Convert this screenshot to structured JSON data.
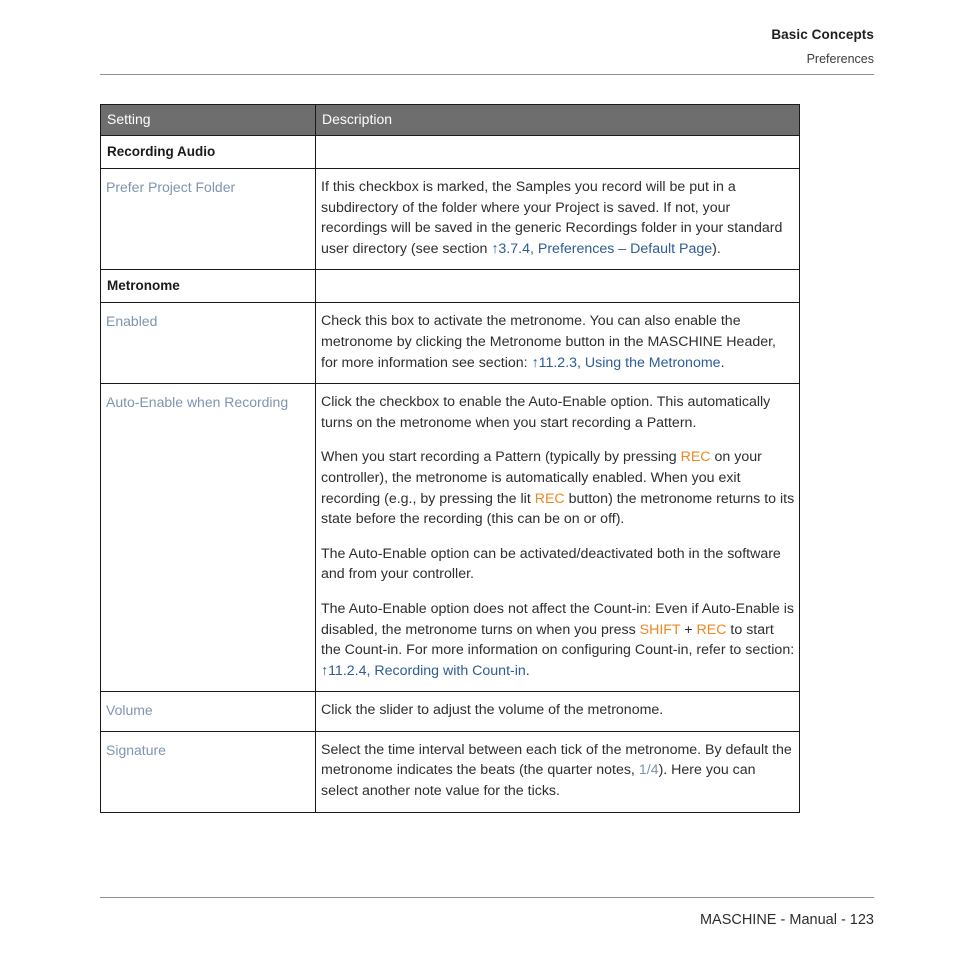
{
  "header": {
    "chapter": "Basic Concepts",
    "section": "Preferences"
  },
  "table": {
    "columns": [
      "Setting",
      "Description"
    ],
    "rows": [
      {
        "type": "group",
        "label": "Recording Audio"
      },
      {
        "type": "entry",
        "setting": "Prefer Project Folder",
        "paragraphs": [
          {
            "parts": [
              {
                "text": "If this checkbox is marked, the Samples you record will be put in a subdirectory of the folder where your Project is saved. If not, your recordings will be saved in the generic Recordings folder in your standard user directory (see section ",
                "style": "plain"
              },
              {
                "text": "↑3.7.4, Preferences – Default Page",
                "style": "xref"
              },
              {
                "text": ").",
                "style": "plain"
              }
            ]
          }
        ]
      },
      {
        "type": "group",
        "label": "Metronome"
      },
      {
        "type": "entry",
        "setting": "Enabled",
        "paragraphs": [
          {
            "parts": [
              {
                "text": "Check this box to activate the metronome. You can also enable the metronome by clicking the Metronome button in the MASCHINE Header, for more information see section: ",
                "style": "plain"
              },
              {
                "text": "↑11.2.3, Using the Metronome",
                "style": "xref"
              },
              {
                "text": ".",
                "style": "plain"
              }
            ]
          }
        ]
      },
      {
        "type": "entry",
        "setting": "Auto-Enable when Recording",
        "paragraphs": [
          {
            "parts": [
              {
                "text": "Click the checkbox to enable the Auto-Enable option. This automatically turns on the metronome when you start recording a Pattern.",
                "style": "plain"
              }
            ]
          },
          {
            "parts": [
              {
                "text": "When you start recording a Pattern (typically by pressing ",
                "style": "plain"
              },
              {
                "text": "REC",
                "style": "rec"
              },
              {
                "text": " on your controller), the metronome is automatically enabled. When you exit recording (e.g., by pressing the lit ",
                "style": "plain"
              },
              {
                "text": "REC",
                "style": "rec"
              },
              {
                "text": " button) the metronome returns to its state before the recording (this can be on or off).",
                "style": "plain"
              }
            ]
          },
          {
            "parts": [
              {
                "text": "The Auto-Enable option can be activated/deactivated both in the software and from your controller.",
                "style": "plain"
              }
            ]
          },
          {
            "parts": [
              {
                "text": "The Auto-Enable option does not affect the Count-in: Even if Auto-Enable is disabled, the metronome turns on when you press ",
                "style": "plain"
              },
              {
                "text": "SHIFT",
                "style": "rec"
              },
              {
                "text": " + ",
                "style": "plain"
              },
              {
                "text": "REC",
                "style": "rec"
              },
              {
                "text": " to start the Count-in. For more information on configuring Count-in, refer to section: ",
                "style": "plain"
              },
              {
                "text": "↑11.2.4, Recording with Count-in",
                "style": "xref"
              },
              {
                "text": ".",
                "style": "plain"
              }
            ]
          }
        ]
      },
      {
        "type": "entry",
        "setting": "Volume",
        "paragraphs": [
          {
            "parts": [
              {
                "text": "Click the slider to adjust the volume of the metronome.",
                "style": "plain"
              }
            ]
          }
        ]
      },
      {
        "type": "entry",
        "setting": "Signature",
        "paragraphs": [
          {
            "parts": [
              {
                "text": "Select the time interval between each tick of the metronome. By default the metronome indicates the beats (the quarter notes, ",
                "style": "plain"
              },
              {
                "text": "1/4",
                "style": "dim"
              },
              {
                "text": "). Here you can select another note value for the ticks.",
                "style": "plain"
              }
            ]
          }
        ]
      }
    ]
  },
  "footer": {
    "text": "MASCHINE - Manual - 123"
  },
  "colors": {
    "header_band": "#6e6e6e",
    "setting_label": "#8094b0",
    "cross_reference": "#2d5c96",
    "hardware_key": "#ee8722",
    "body_text": "#2e2e2e",
    "rule": "#8f8f8f"
  }
}
